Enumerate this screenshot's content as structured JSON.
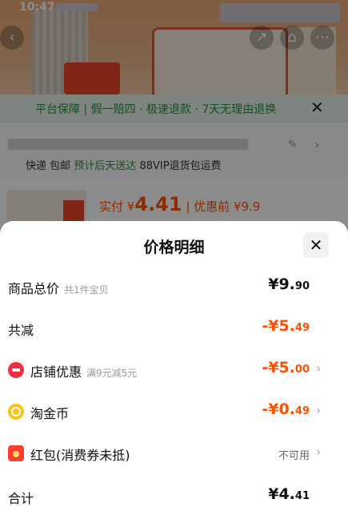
{
  "status": {
    "time": "10:47"
  },
  "background": {
    "guarantee_text": "平台保障 | 假一赔四 · 极速退款 · 7天无理由退换",
    "shipping_prefix": "快递 包邮",
    "shipping_highlight": "预计后天送达",
    "shipping_suffix": "88VIP退货包运费",
    "price_prefix": "实付 ¥",
    "price_value": "4.41",
    "price_before": "| 优惠前 ¥9.9"
  },
  "panel": {
    "title": "价格明细",
    "rows": [
      {
        "label": "商品总价",
        "sub": "共1件宝贝",
        "value_int": "¥9.",
        "value_dec": "90"
      },
      {
        "label": "共减",
        "value_int": "-¥5.",
        "value_dec": "49"
      },
      {
        "label": "店铺优惠",
        "sub": "满9元减5元",
        "value_int": "-¥5.",
        "value_dec": "00"
      },
      {
        "label": "淘金币",
        "value_int": "-¥0.",
        "value_dec": "49"
      },
      {
        "label": "红包(消费券未抵)",
        "value": "不可用"
      },
      {
        "label": "合计",
        "value_int": "¥4.",
        "value_dec": "41"
      }
    ]
  },
  "icons": {
    "close": "✕",
    "chevron": "›"
  },
  "colors": {
    "accent": "#ff5000",
    "green": "#2f8f3d"
  }
}
